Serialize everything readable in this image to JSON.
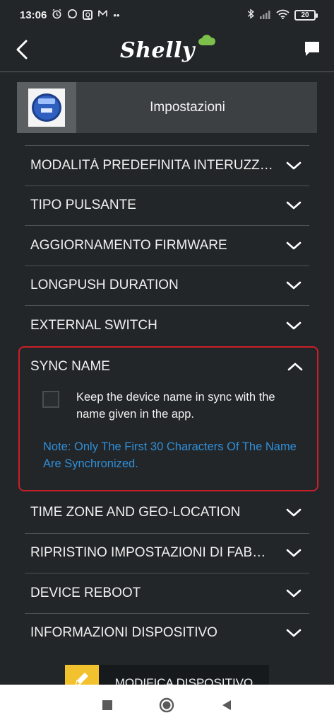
{
  "status_bar": {
    "time": "13:06",
    "left_icons": [
      "alarm-icon",
      "whatsapp-icon",
      "app-q-icon",
      "mail-icon",
      "more-dots-icon"
    ],
    "q_letter": "Q",
    "dots": "••",
    "right_icons": [
      "bluetooth-icon",
      "signal-icon",
      "wifi-icon",
      "battery-icon"
    ],
    "battery": "20"
  },
  "app_bar": {
    "brand": "Shelly",
    "accent": "#7cc04b"
  },
  "header": {
    "title": "Impostazioni"
  },
  "settings": [
    {
      "label": "MODALITÀ PREDEFINITA INTERUZZI…"
    },
    {
      "label": "TIPO PULSANTE"
    },
    {
      "label": "AGGIORNAMENTO FIRMWARE"
    },
    {
      "label": "LONGPUSH DURATION"
    },
    {
      "label": "EXTERNAL SWITCH"
    }
  ],
  "sync_name": {
    "label": "SYNC NAME",
    "expanded": true,
    "checkbox_checked": false,
    "checkbox_text": "Keep the device name in sync with the name given in the app.",
    "note": "Note: Only The First 30 Characters Of The Name Are Synchronized.",
    "highlight_color": "#c8202a",
    "note_color": "#2f8fd9"
  },
  "settings_lower": [
    {
      "label": "TIME ZONE AND GEO-LOCATION"
    },
    {
      "label": "RIPRISTINO IMPOSTAZIONI DI FABBR…"
    },
    {
      "label": "DEVICE REBOOT"
    },
    {
      "label": "INFORMAZIONI DISPOSITIVO"
    }
  ],
  "edit_button": {
    "label": "MODIFICA DISPOSITIVO",
    "icon": "pencil-icon",
    "icon_bg": "#f2c12e"
  },
  "nav_bar": {
    "buttons": [
      "recents-square-icon",
      "home-circle-icon",
      "back-triangle-icon"
    ]
  }
}
